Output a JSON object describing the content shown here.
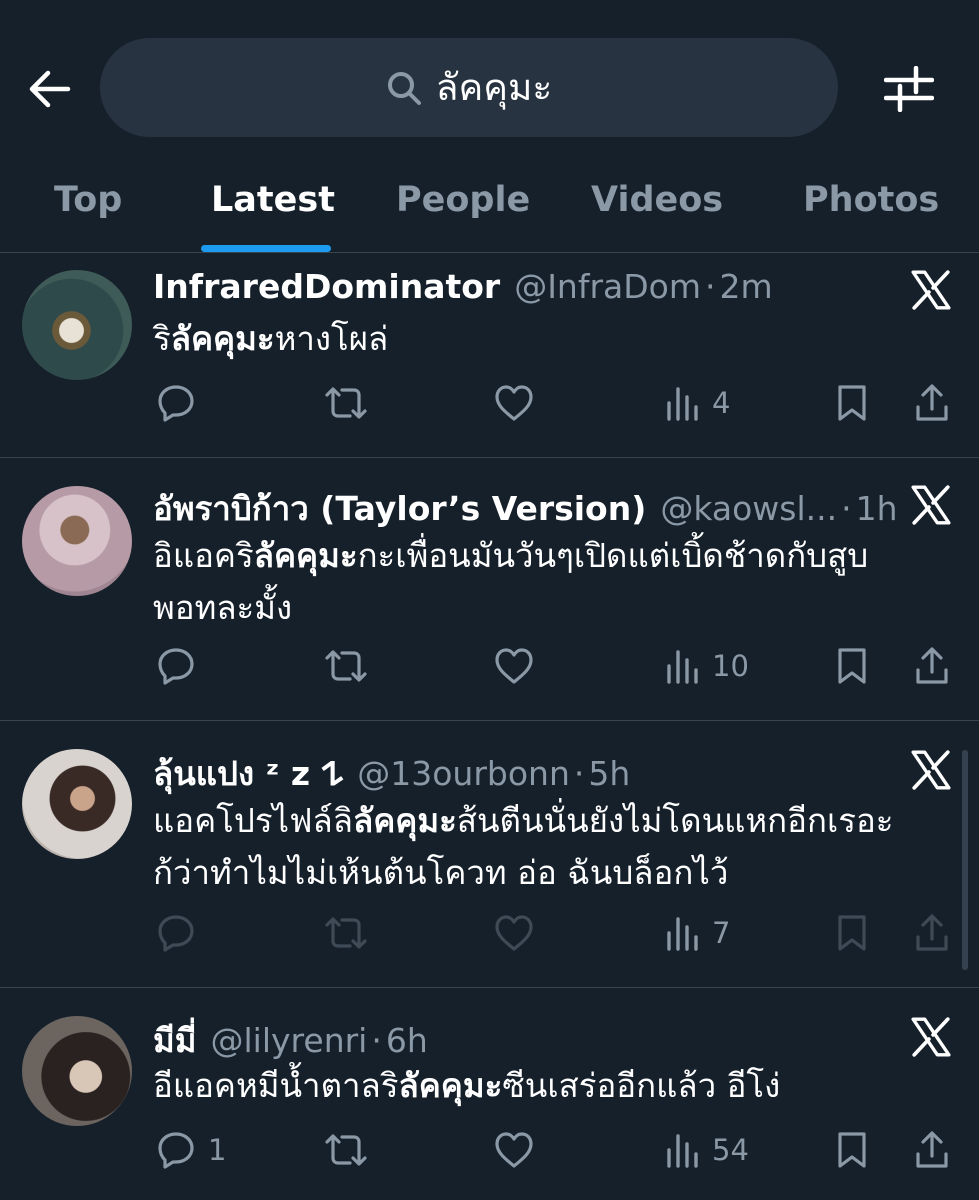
{
  "search": {
    "query": "ลัคคุมะ"
  },
  "tabs": [
    {
      "label": "Top"
    },
    {
      "label": "Latest"
    },
    {
      "label": "People"
    },
    {
      "label": "Videos"
    },
    {
      "label": "Photos"
    }
  ],
  "active_tab": "Latest",
  "posts": [
    {
      "name": "InfraredDominator",
      "handle": "@InfraDom",
      "sep": "·",
      "time": "2m",
      "text": {
        "pre": "ริ",
        "bold": "ลัคคุมะ",
        "post": "หางโผล่"
      },
      "text2": "",
      "replies": "",
      "views": "4"
    },
    {
      "name": "อัพราบิก้าว (Taylor’s Version)",
      "handle": "@kaowsl...",
      "sep": "·",
      "time": "1h",
      "text": {
        "pre": "อิแอคริ",
        "bold": "ลัคคุมะ",
        "post": "กะเพื่อนมันวันๆเปิดแต่เบิ้ดช้าดกับสูบ"
      },
      "text2": "พอทละมั้ง",
      "replies": "",
      "views": "10"
    },
    {
      "name": "ลุ้นแปง ᶻ z 𐰁",
      "handle": "@13ourbonn",
      "sep": "·",
      "time": "5h",
      "text": {
        "pre": "แอคโปรไฟล์ลิ",
        "bold": "ลัคคุมะ",
        "post": "ส้นตีนนั่นยังไม่โดนแหกอีกเรอะ"
      },
      "text2": "ก้ว่าทำไมไม่เห้นต้นโควท อ่อ ฉันบล็อกไว้",
      "replies": "",
      "views": "7"
    },
    {
      "name": "มีมี่",
      "handle": "@lilyrenri",
      "sep": "·",
      "time": "6h",
      "text": {
        "pre": "อีแอคหมีน้ำตาลริ",
        "bold": "ลัคคุมะ",
        "post": "ซีนเสร่ออีกแล้ว อีโง่"
      },
      "text2": "",
      "replies": "1",
      "views": "54"
    }
  ],
  "colors": {
    "background": "#15202b",
    "search_bg": "#273340",
    "muted": "#8b98a5",
    "accent": "#1d9bf0",
    "divider": "#38444d"
  },
  "icons": {
    "back": "back-arrow-icon",
    "search": "search-icon",
    "filter": "filter-sliders-icon",
    "x_logo": "x-logo-icon",
    "reply": "reply-icon",
    "repost": "repost-icon",
    "like": "heart-icon",
    "views": "views-icon",
    "bookmark": "bookmark-icon",
    "share": "share-icon"
  }
}
